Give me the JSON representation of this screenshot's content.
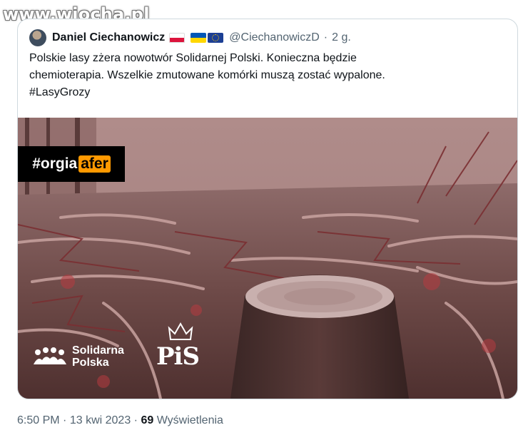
{
  "watermark": "www.wiocha.pl",
  "quoted_tweet": {
    "author": {
      "name": "Daniel Ciechanowicz",
      "flag_icons": [
        "poland-flag-icon",
        "ukraine-flag-icon",
        "eu-flag-icon"
      ],
      "handle": "@CiechanowiczD",
      "separator": "·",
      "time_ago": "2 g."
    },
    "text_lines": [
      "Polskie lasy zżera nowotwór Solidarnej Polski. Konieczna będzie",
      "chemioterapia. Wszelkie zmutowane komórki muszą zostać wypalone.",
      "#LasyGrozy"
    ],
    "media": {
      "tag_prefix": "#orgia",
      "tag_highlight": "afer",
      "logo_solidarna": [
        "Solidarna",
        "Polska"
      ],
      "logo_pis": "PiS"
    }
  },
  "meta": {
    "time": "6:50 PM",
    "separator": "·",
    "date": "13 kwi 2023",
    "views_count": "69",
    "views_label": "Wyświetlenia"
  },
  "colors": {
    "text_primary": "#0f1419",
    "text_secondary": "#536471",
    "border": "#cfd9de",
    "tag_highlight": "#ff9900"
  }
}
